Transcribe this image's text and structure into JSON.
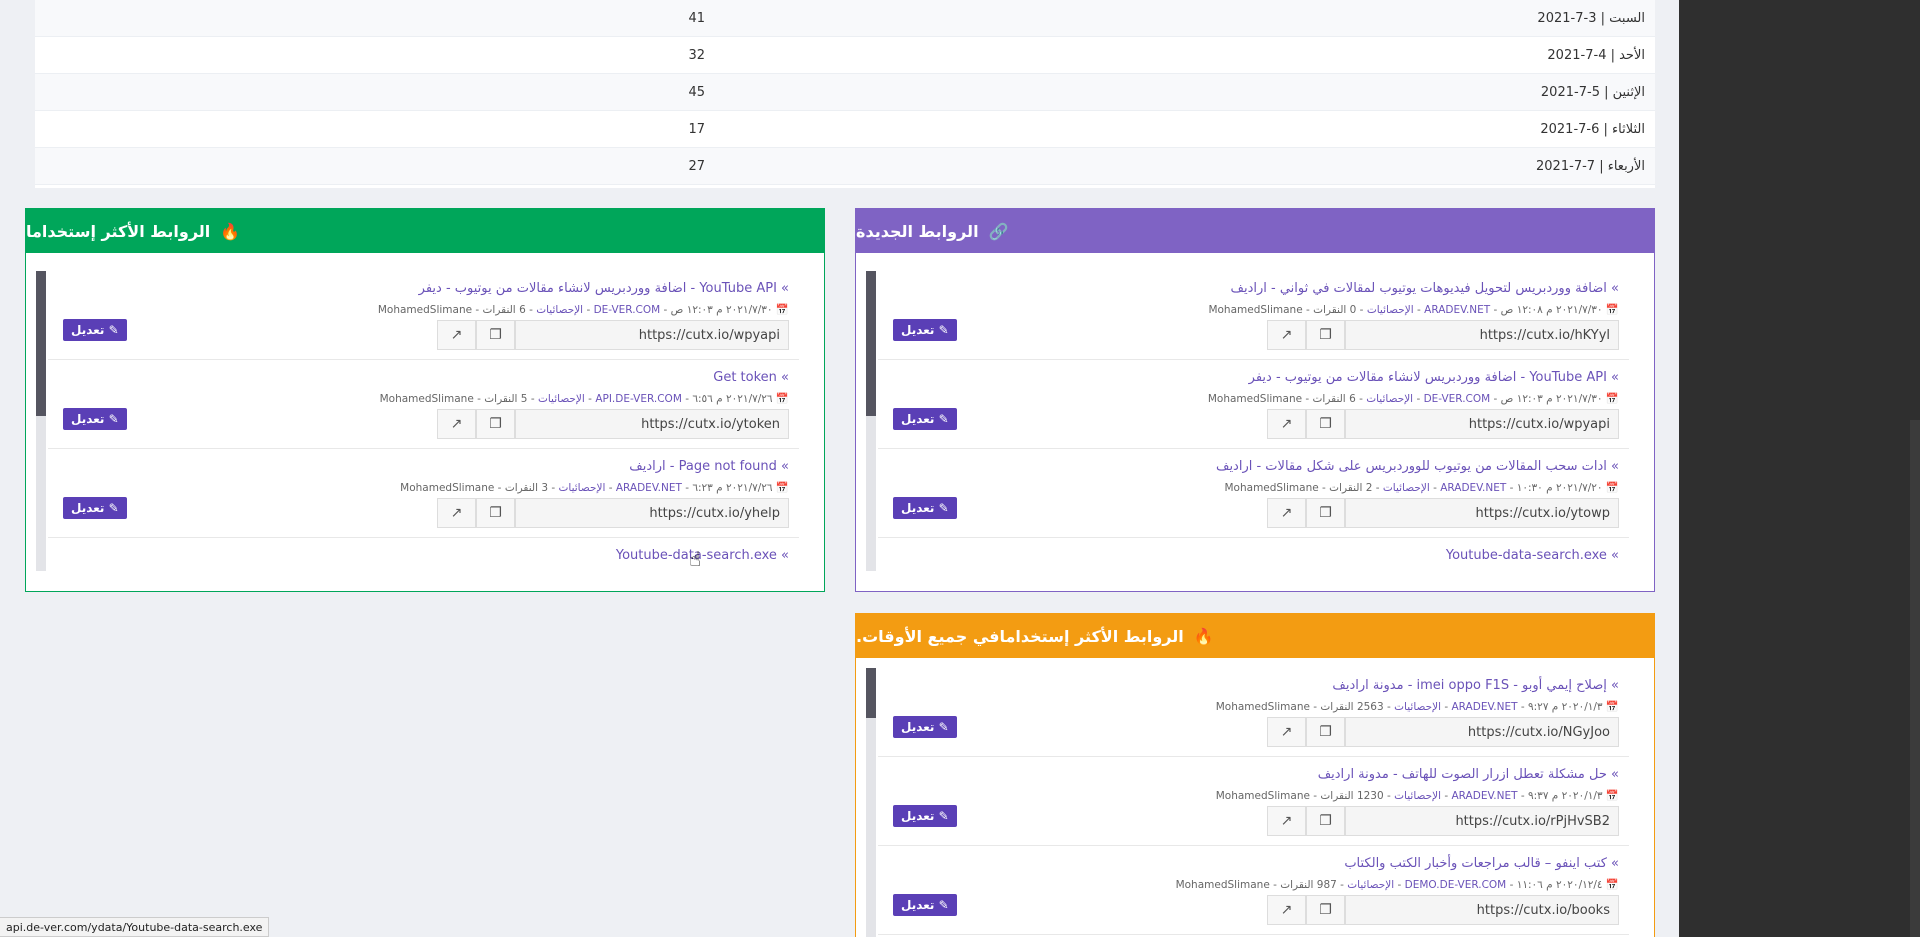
{
  "days": [
    {
      "label": "السبت | 3-7-2021",
      "count": "41"
    },
    {
      "label": "الأحد | 4-7-2021",
      "count": "32"
    },
    {
      "label": "الإثنين | 5-7-2021",
      "count": "45"
    },
    {
      "label": "الثلاثاء | 6-7-2021",
      "count": "17"
    },
    {
      "label": "الأربعاء | 7-7-2021",
      "count": "27"
    }
  ],
  "colors": {
    "purple": "#7f63c4",
    "green": "#00a65a",
    "orange": "#f39c12",
    "edit": "#5a3fb6"
  },
  "edit_label": "تعديل",
  "new_links": {
    "title": "الروابط الجديدة",
    "icon": "link-icon",
    "items": [
      {
        "title": "اضافة ووردبريس لتحويل فيديوهات يوتيوب لمقالات في ثواني - اراديف",
        "meta_date": "٢٠٢١/٧/٣٠ م ١٢:٠٨ ص",
        "meta_domain": "ARADEV.NET",
        "meta_stats": "الإحصائيات",
        "meta_clicks": "0 النقرات",
        "meta_user": "MohamedSlimane",
        "url": "https://cutx.io/hKYyl"
      },
      {
        "title": "YouTube API - اضافة ووردبريس لانشاء مقالات من يوتيوب - ديفر",
        "meta_date": "٢٠٢١/٧/٣٠ م ١٢:٠٣ ص",
        "meta_domain": "DE-VER.COM",
        "meta_stats": "الإحصائيات",
        "meta_clicks": "6 النقرات",
        "meta_user": "MohamedSlimane",
        "url": "https://cutx.io/wpyapi"
      },
      {
        "title": "ادات سحب المقالات من يوتيوب للووردبريس على شكل مقالات - اراديف",
        "meta_date": "٢٠٢١/٧/٢٠ م ١٠:٣٠",
        "meta_domain": "ARADEV.NET",
        "meta_stats": "الإحصائيات",
        "meta_clicks": "2 النقرات",
        "meta_user": "MohamedSlimane",
        "url": "https://cutx.io/ytowp"
      }
    ],
    "last": "Youtube-data-search.exe"
  },
  "most_used": {
    "title": "الروابط الأكثر إستخداما",
    "icon": "fire-icon",
    "items": [
      {
        "title": "YouTube API - اضافة ووردبريس لانشاء مقالات من يوتيوب - ديفر",
        "meta_date": "٢٠٢١/٧/٣٠ م ١٢:٠٣ ص",
        "meta_domain": "DE-VER.COM",
        "meta_stats": "الإحصائيات",
        "meta_clicks": "6 النقرات",
        "meta_user": "MohamedSlimane",
        "url": "https://cutx.io/wpyapi"
      },
      {
        "title": "Get token",
        "meta_date": "٢٠٢١/٧/٢٦ م ٦:٥٦",
        "meta_domain": "API.DE-VER.COM",
        "meta_stats": "الإحصائيات",
        "meta_clicks": "5 النقرات",
        "meta_user": "MohamedSlimane",
        "url": "https://cutx.io/ytoken"
      },
      {
        "title": "Page not found - اراديف",
        "meta_date": "٢٠٢١/٧/٢٦ م ٦:٢٣",
        "meta_domain": "ARADEV.NET",
        "meta_stats": "الإحصائيات",
        "meta_clicks": "3 النقرات",
        "meta_user": "MohamedSlimane",
        "url": "https://cutx.io/yhelp"
      }
    ],
    "last": "Youtube-data-search.exe"
  },
  "all_time": {
    "title": "الروابط الأكثر إستخدامافي جميع الأوقات.",
    "icon": "fire-icon",
    "items": [
      {
        "title": "إصلاح إيمي أوبو - imei oppo F1S - مدونة اراديف",
        "meta_date": "٢٠٢٠/١/٣ م ٩:٢٧",
        "meta_domain": "ARADEV.NET",
        "meta_stats": "الإحصائيات",
        "meta_clicks": "2563 النقرات",
        "meta_user": "MohamedSlimane",
        "url": "https://cutx.io/NGyJoo"
      },
      {
        "title": "حل مشكلة تعطل ازرار الصوت للهاتف - مدونة اراديف",
        "meta_date": "٢٠٢٠/١/٣ م ٩:٣٧",
        "meta_domain": "ARADEV.NET",
        "meta_stats": "الإحصائيات",
        "meta_clicks": "1230 النقرات",
        "meta_user": "MohamedSlimane",
        "url": "https://cutx.io/rPjHvSB2"
      },
      {
        "title": "كتب اينفو – قالب مراجعات وأخبار الكتب والكتاب",
        "meta_date": "٢٠٢٠/١٢/٤ م ١١:٠٦",
        "meta_domain": "DEMO.DE-VER.COM",
        "meta_stats": "الإحصائيات",
        "meta_clicks": "987 النقرات",
        "meta_user": "MohamedSlimane",
        "url": "https://cutx.io/books"
      }
    ]
  },
  "status_url": "api.de-ver.com/ydata/Youtube-data-search.exe"
}
